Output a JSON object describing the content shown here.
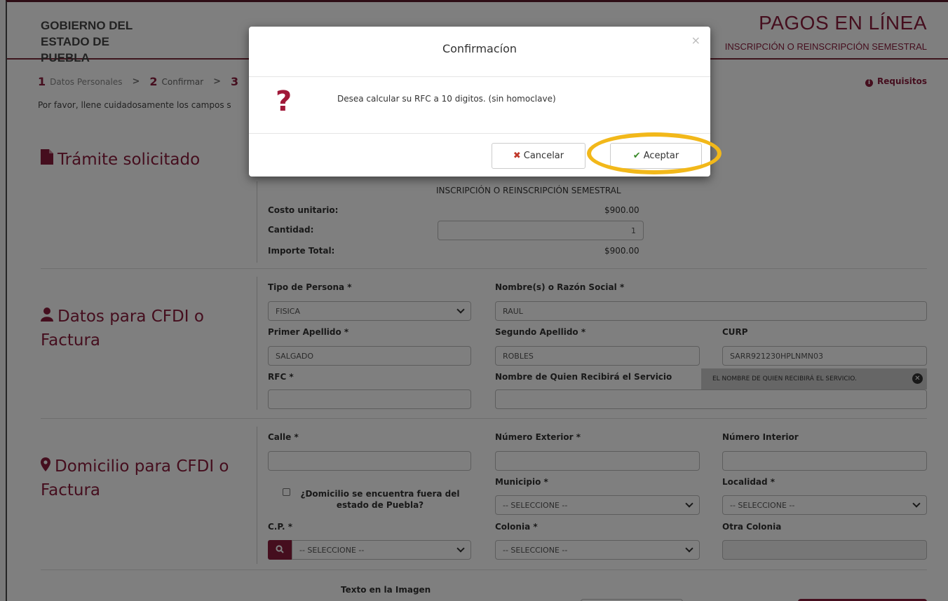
{
  "header": {
    "brand": "GOBIERNO DEL ESTADO DE PUEBLA",
    "title": "PAGOS EN LÍNEA",
    "subtitle": "INSCRIPCIÓN O REINSCRIPCIÓN SEMESTRAL"
  },
  "steps": [
    {
      "num": "1",
      "label": "Datos Personales"
    },
    {
      "num": "2",
      "label": "Confirmar"
    },
    {
      "num": "3",
      "label": ""
    }
  ],
  "requisitos_label": "Requisitos",
  "instructions": "Por favor, llene cuidadosamente los campos s",
  "tramite": {
    "section_title": "Trámite solicitado",
    "concept": "INSCRIPCIÓN O REINSCRIPCIÓN SEMESTRAL",
    "costo_label": "Costo unitario:",
    "costo_value": "$900.00",
    "cantidad_label": "Cantidad:",
    "cantidad_value": "1",
    "importe_label": "Importe Total:",
    "importe_value": "$900.00"
  },
  "cfdi": {
    "section_title": "Datos para CFDI o Factura",
    "tipo_persona_label": "Tipo de Persona *",
    "tipo_persona_value": "FISICA",
    "nombre_label": "Nombre(s) o Razón Social *",
    "nombre_value": "RAUL",
    "primer_apellido_label": "Primer Apellido *",
    "primer_apellido_value": "SALGADO",
    "segundo_apellido_label": "Segundo Apellido *",
    "segundo_apellido_value": "ROBLES",
    "curp_label": "CURP",
    "curp_value": "SARR921230HPLNMN03",
    "rfc_label": "RFC *",
    "rfc_value": "",
    "receptor_label": "Nombre de Quien Recibirá el Servicio",
    "receptor_value": "",
    "tooltip_text": "EL NOMBRE DE QUIEN RECIBIRÁ EL SERVICIO."
  },
  "domicilio": {
    "section_title": "Domicilio para CFDI o Factura",
    "calle_label": "Calle *",
    "num_ext_label": "Número Exterior *",
    "num_int_label": "Número Interior",
    "fuera_label": "¿Domicilio se encuentra fuera del estado de Puebla?",
    "municipio_label": "Municipio *",
    "municipio_value": "-- SELECCIONE --",
    "localidad_label": "Localidad *",
    "localidad_value": "-- SELECCIONE --",
    "cp_label": "C.P. *",
    "cp_value": "-- SELECCIONE --",
    "colonia_label": "Colonia *",
    "colonia_value": "-- SELECCIONE --",
    "otra_colonia_label": "Otra Colonia"
  },
  "captcha": {
    "label": "Texto en la Imagen"
  },
  "modal": {
    "title": "Confirmacíon",
    "close": "×",
    "icon": "?",
    "message": "Desea calcular su RFC a 10 digitos. (sin homoclave)",
    "cancel_label": "Cancelar",
    "accept_label": "Aceptar"
  },
  "colors": {
    "brand": "#8a1c3c",
    "highlight": "#f2b81a"
  }
}
